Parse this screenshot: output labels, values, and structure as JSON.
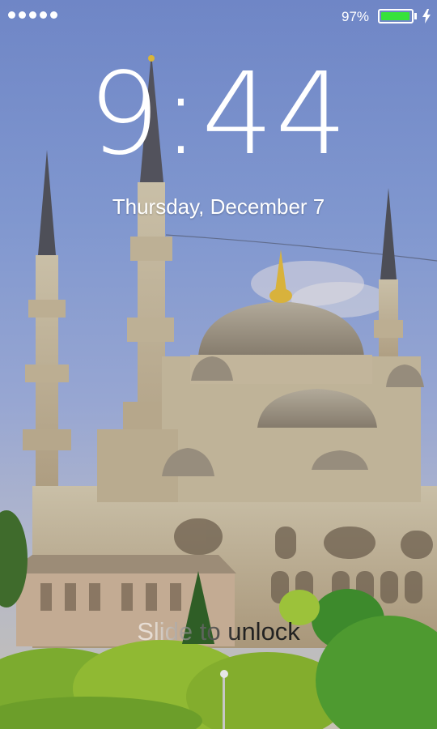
{
  "status_bar": {
    "signal_dots": 5,
    "battery_text": "97%",
    "battery_level": 0.97,
    "battery_color": "#37e23b",
    "charging_icon": "lightning-bolt-icon"
  },
  "lock_screen": {
    "time": "9:44",
    "date": "Thursday, December 7",
    "unlock_hint": "Slide to unlock",
    "wallpaper": "mosque-wallpaper"
  }
}
